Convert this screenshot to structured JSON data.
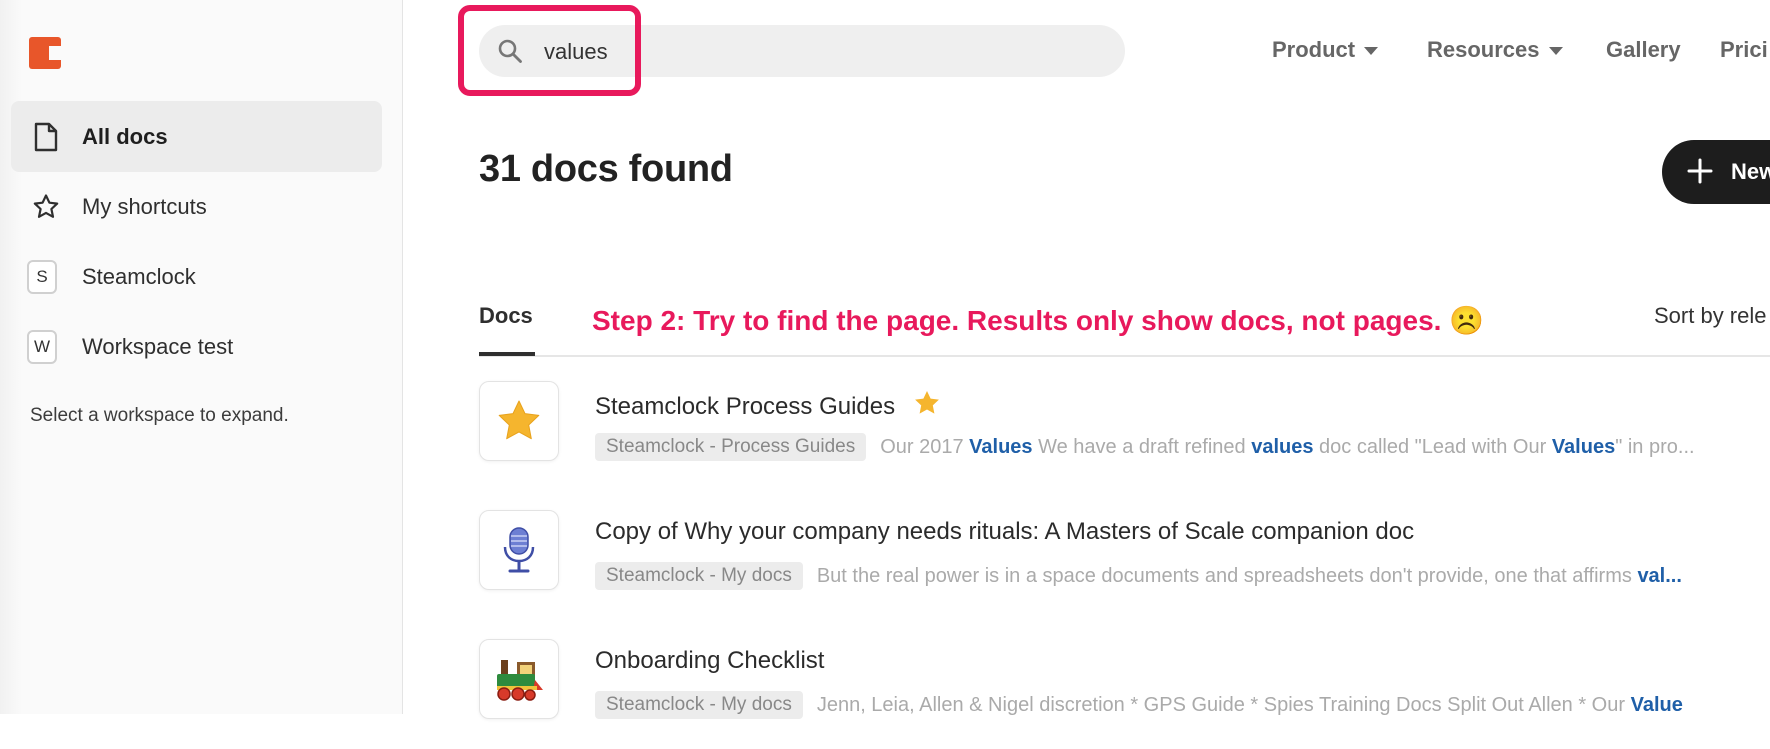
{
  "sidebar": {
    "items": [
      {
        "label": "All docs",
        "icon": "document-icon"
      },
      {
        "label": "My shortcuts",
        "icon": "star-outline-icon"
      },
      {
        "label": "Steamclock",
        "badge": "S"
      },
      {
        "label": "Workspace test",
        "badge": "W"
      }
    ],
    "hint": "Select a workspace to expand."
  },
  "search": {
    "value": "values"
  },
  "nav": {
    "product": "Product",
    "resources": "Resources",
    "gallery": "Gallery",
    "pricing": "Prici"
  },
  "main": {
    "heading": "31 docs found",
    "new_label": "New",
    "tab_docs": "Docs",
    "annotation": "Step 2: Try to find the page. Results only show docs, not pages. ☹️",
    "sort_label": "Sort by rele"
  },
  "results": [
    {
      "title": "Steamclock Process Guides",
      "icon": "star-icon",
      "tag": "Steamclock - Process Guides",
      "snippet": [
        "Our 2017 ",
        "Values",
        " We have a draft refined ",
        "values",
        " doc called \"Lead with Our ",
        "Values",
        "\" in pro..."
      ]
    },
    {
      "title": "Copy of Why your company needs rituals: A Masters of Scale companion doc",
      "icon": "microphone-icon",
      "tag": "Steamclock - My docs",
      "snippet": [
        "But the real power is in a space documents and spreadsheets don't provide, one that affirms ",
        "val..."
      ]
    },
    {
      "title": "Onboarding Checklist",
      "icon": "locomotive-icon",
      "tag": "Steamclock - My docs",
      "snippet": [
        "Jenn, Leia, Allen & Nigel discretion * GPS Guide * Spies Training Docs Split Out Allen * Our ",
        "Value"
      ]
    }
  ],
  "colors": {
    "accent": "#e8195c",
    "logo": "#e8562a",
    "highlight_text": "#1f5fa8"
  }
}
